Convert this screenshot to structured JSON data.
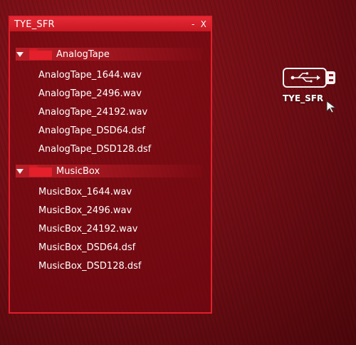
{
  "window": {
    "title": "TYE_SFR",
    "minimize_label": "-",
    "close_label": "X"
  },
  "folders": [
    {
      "name": "AnalogTape",
      "files": [
        "AnalogTape_1644.wav",
        "AnalogTape_2496.wav",
        "AnalogTape_24192.wav",
        "AnalogTape_DSD64.dsf",
        "AnalogTape_DSD128.dsf"
      ]
    },
    {
      "name": "MusicBox",
      "files": [
        "MusicBox_1644.wav",
        "MusicBox_2496.wav",
        "MusicBox_24192.wav",
        "MusicBox_DSD64.dsf",
        "MusicBox_DSD128.dsf"
      ]
    }
  ],
  "desktop_icon": {
    "label": "TYE_SFR",
    "icon": "usb-drive-icon"
  },
  "colors": {
    "accent": "#e11f2b",
    "background": "#6e0d14"
  }
}
